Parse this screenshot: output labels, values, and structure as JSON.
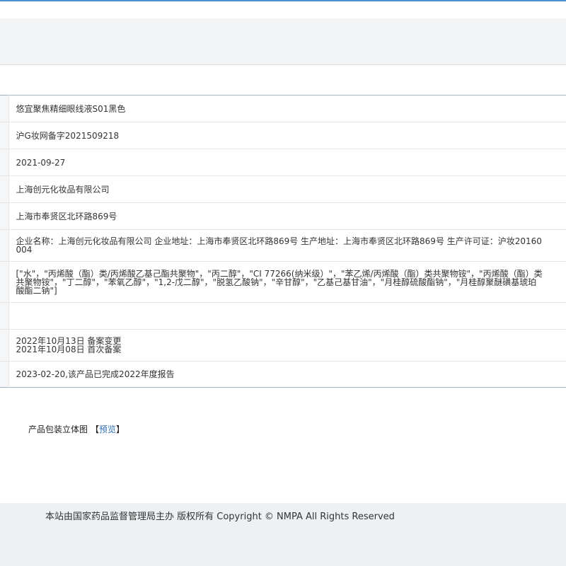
{
  "product": {
    "name": "悠宜聚焦精细眼线液S01黑色",
    "record_no": "沪G妆网备字2021509218",
    "record_date": "2021-09-27",
    "registrant": "上海创元化妆品有限公司",
    "registrant_address": "上海市奉贤区北环路869号",
    "manufacturer_info": "企业名称：上海创元化妆品有限公司 企业地址：上海市奉贤区北环路869号 生产地址：上海市奉贤区北环路869号 生产许可证：沪妆20160004",
    "ingredients": "[\"水\"，\"丙烯酸（酯）类/丙烯酸乙基己酯共聚物\"，\"丙二醇\"，\"CI 77266(纳米级）\"，\"苯乙烯/丙烯酸（酯）类共聚物铵\"，\"丙烯酸（酯）类共聚物铵\"，\"丁二醇\"，\"苯氧乙醇\"，\"1,2-戊二醇\"，\"脱氢乙酸钠\"，\"辛甘醇\"，\"乙基己基甘油\"，\"月桂醇硫酸酯钠\"，\"月桂醇聚醚磺基琥珀酸酯二钠\"]",
    "empty_field": "",
    "history": [
      "2022年10月13日 备案变更",
      "2021年10月08日 首次备案"
    ],
    "annual_report": "2023-02-20,该产品已完成2022年度报告"
  },
  "package": {
    "label": "产品包装立体图",
    "bracket_open": "【",
    "preview_link": "预览",
    "bracket_close": "】"
  },
  "footer": {
    "text": "本站由国家药品监督管理局主办 版权所有 Copyright © NMPA All Rights Reserved"
  }
}
